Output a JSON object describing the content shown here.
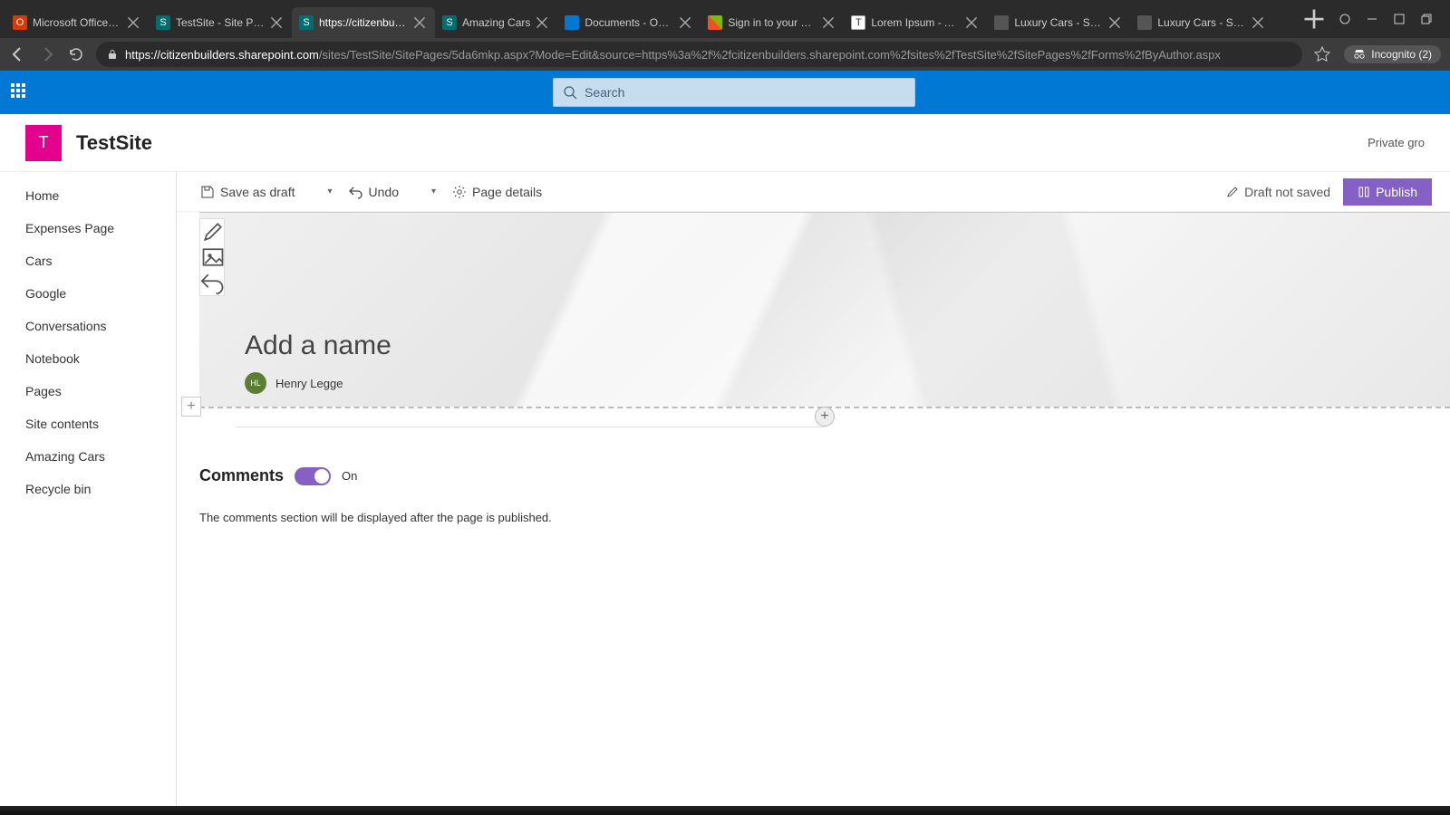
{
  "browser": {
    "tabs": [
      {
        "title": "Microsoft Office Home",
        "fav": "o"
      },
      {
        "title": "TestSite - Site Pages -",
        "fav": "sp"
      },
      {
        "title": "https://citizenbuilders",
        "fav": "sp",
        "active": true
      },
      {
        "title": "Amazing Cars",
        "fav": "sp"
      },
      {
        "title": "Documents - OneDriv",
        "fav": "od"
      },
      {
        "title": "Sign in to your accoun",
        "fav": "ms"
      },
      {
        "title": "Lorem Ipsum - All the",
        "fav": "txt"
      },
      {
        "title": "Luxury Cars - Sedans,",
        "fav": "mb"
      },
      {
        "title": "Luxury Cars - Sedans,",
        "fav": "mb"
      }
    ],
    "url_host": "https://citizenbuilders.sharepoint.com",
    "url_path": "/sites/TestSite/SitePages/5da6mkp.aspx?Mode=Edit&source=https%3a%2f%2fcitizenbuilders.sharepoint.com%2fsites%2fTestSite%2fSitePages%2fForms%2fByAuthor.aspx",
    "incognito_label": "Incognito (2)"
  },
  "suite": {
    "search_placeholder": "Search"
  },
  "site": {
    "logo_initial": "T",
    "title": "TestSite",
    "privacy": "Private gro"
  },
  "nav": {
    "items": [
      "Home",
      "Expenses Page",
      "Cars",
      "Google",
      "Conversations",
      "Notebook",
      "Pages",
      "Site contents",
      "Amazing Cars",
      "Recycle bin"
    ]
  },
  "commandbar": {
    "save_label": "Save as draft",
    "undo_label": "Undo",
    "details_label": "Page details",
    "draft_status": "Draft not saved",
    "publish_label": "Publish"
  },
  "hero": {
    "title_placeholder": "Add a name",
    "author_initials": "HL",
    "author_name": "Henry Legge"
  },
  "comments": {
    "heading": "Comments",
    "state_label": "On",
    "note": "The comments section will be displayed after the page is published."
  }
}
